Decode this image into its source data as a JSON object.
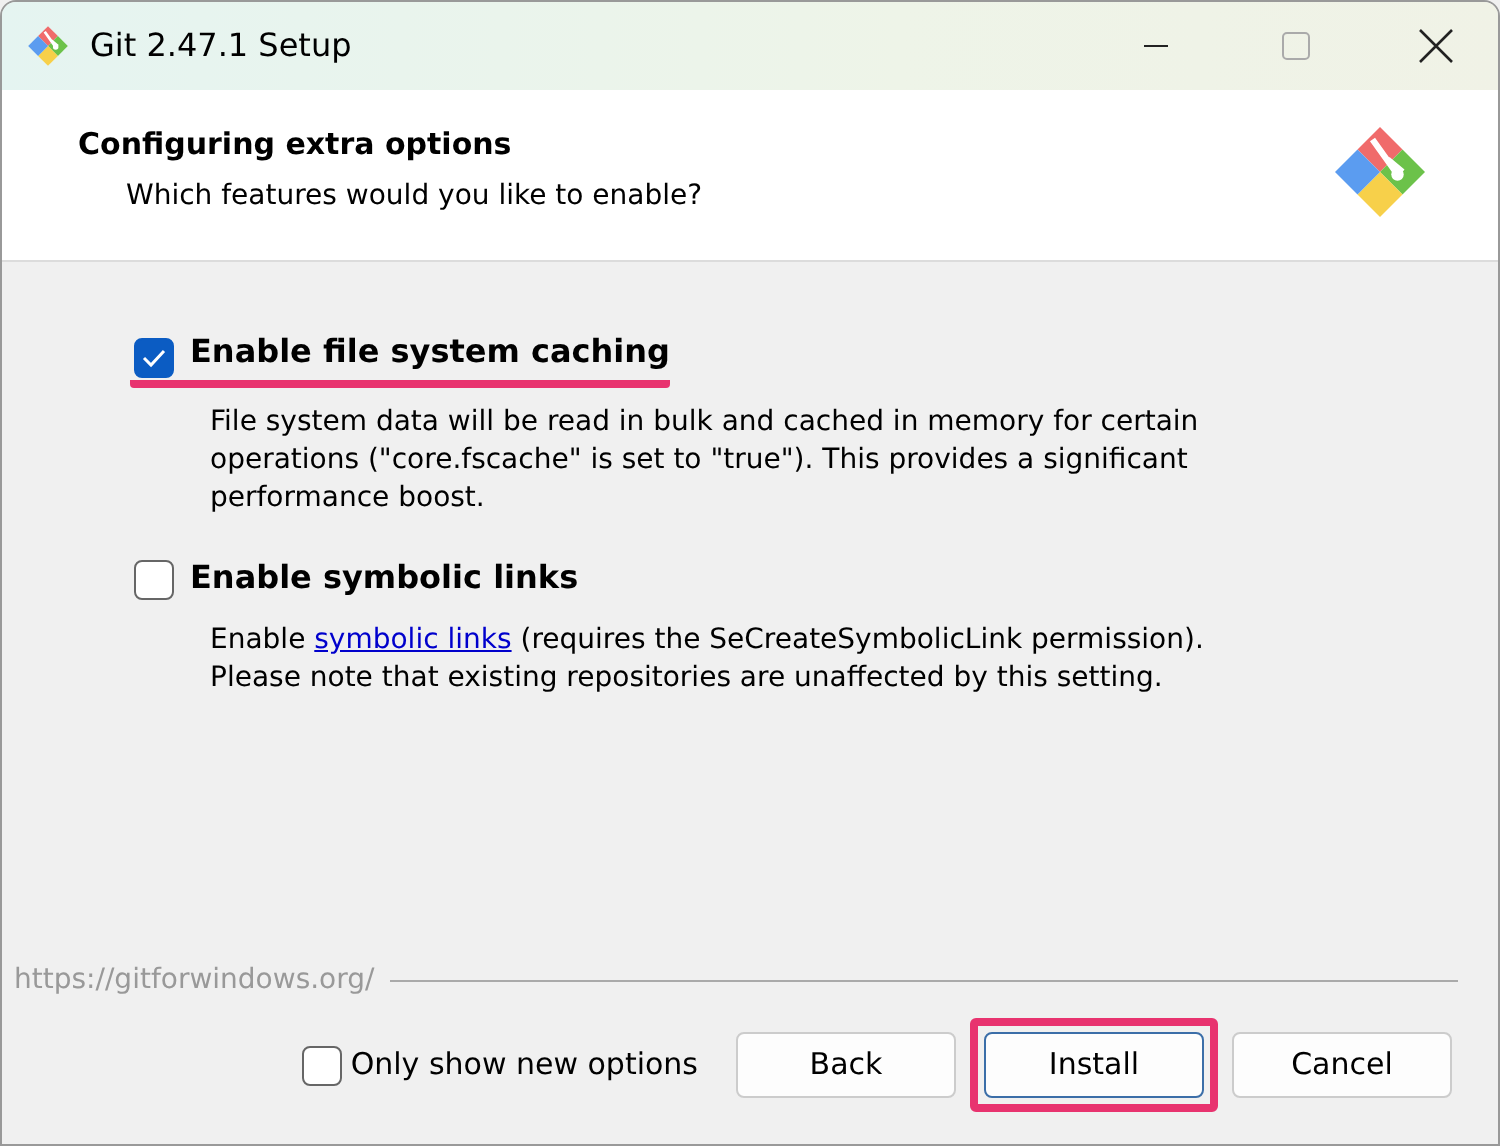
{
  "window": {
    "title": "Git 2.47.1 Setup"
  },
  "header": {
    "title": "Configuring extra options",
    "subtitle": "Which features would you like to enable?"
  },
  "options": [
    {
      "label": "Enable file system caching",
      "checked": true,
      "highlighted": true,
      "description": [
        {
          "text": "File system data will be read in bulk and cached in memory for certain operations (\"core.fscache\" is set to \"true\"). This provides a significant performance boost.",
          "link": false
        }
      ]
    },
    {
      "label": "Enable symbolic links",
      "checked": false,
      "highlighted": false,
      "description": [
        {
          "text": "Enable ",
          "link": false
        },
        {
          "text": "symbolic links",
          "link": true
        },
        {
          "text": " (requires the SeCreateSymbolicLink permission). Please note that existing repositories are unaffected by this setting.",
          "link": false
        }
      ]
    }
  ],
  "footer": {
    "url": "https://gitforwindows.org/",
    "only_new": {
      "label": "Only show new options",
      "checked": false
    },
    "buttons": [
      {
        "label": "Back",
        "highlighted": false
      },
      {
        "label": "Install",
        "highlighted": true
      },
      {
        "label": "Cancel",
        "highlighted": false
      }
    ]
  }
}
